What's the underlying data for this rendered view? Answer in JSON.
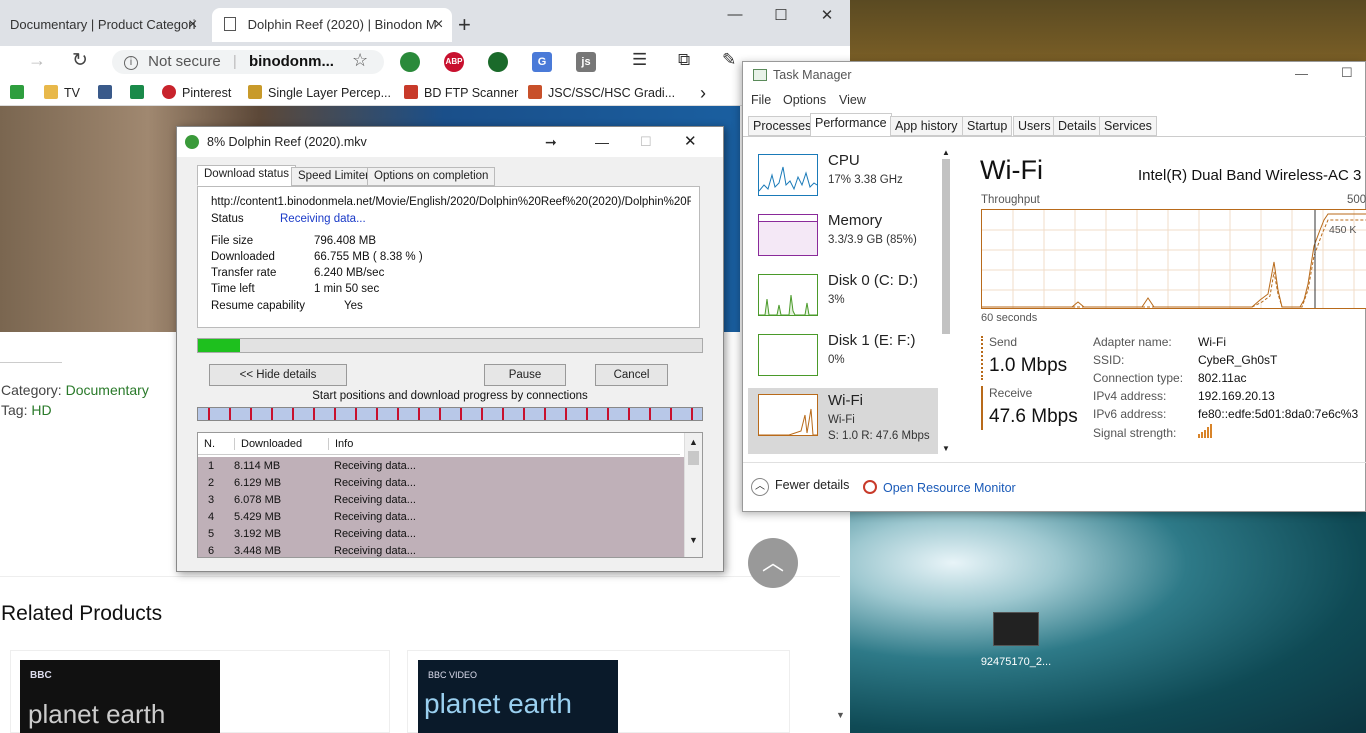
{
  "browser": {
    "tabs": [
      {
        "label": "Documentary | Product Categori",
        "close": "×"
      },
      {
        "label": "Dolphin Reef (2020) | Binodon M",
        "close": "×"
      }
    ],
    "new_tab": "+",
    "window_controls": {
      "minimize": "—",
      "maximize": "☐",
      "close": "✕"
    },
    "not_secure": "Not secure",
    "url": "binodonm...",
    "bookmarks": [
      {
        "label": "",
        "color": "#2e9e3e",
        "icon": "upwork-icon"
      },
      {
        "label": "TV",
        "color": "#e8b84a",
        "icon": "folder-icon"
      },
      {
        "label": "",
        "color": "#3a5a8a",
        "icon": "search-q-icon"
      },
      {
        "label": "",
        "color": "#1a8a4a",
        "icon": "green-plus-icon"
      },
      {
        "label": "Pinterest",
        "color": "#c8232c",
        "icon": "pinterest-icon"
      },
      {
        "label": "Single Layer Percep...",
        "color": "#c89a2a",
        "icon": "page-icon"
      },
      {
        "label": "BD FTP Scanner",
        "color": "#c83a2a",
        "icon": "ftp-icon"
      },
      {
        "label": "JSC/SSC/HSC Gradi...",
        "color": "#c8502a",
        "icon": "edu-icon"
      }
    ],
    "bookmarks_more": "›"
  },
  "page": {
    "category_label": "Category:",
    "category_value": "Documentary",
    "tag_label": "Tag:",
    "tag_value": "HD",
    "related_heading": "Related Products",
    "products": [
      {
        "badge": "BBC",
        "title": "planet earth"
      },
      {
        "badge": "BBC VIDEO",
        "title": "planet earth"
      }
    ],
    "scroll_top": "︿"
  },
  "idm": {
    "title": "8% Dolphin Reef (2020).mkv",
    "tabs": [
      "Download status",
      "Speed Limiter",
      "Options on completion"
    ],
    "url": "http://content1.binodonmela.net/Movie/English/2020/Dolphin%20Reef%20(2020)/Dolphin%20Ree",
    "status_label": "Status",
    "status_value": "Receiving data...",
    "fields": [
      {
        "label": "File size",
        "value": "796.408  MB"
      },
      {
        "label": "Downloaded",
        "value": "66.755  MB  ( 8.38 % )"
      },
      {
        "label": "Transfer rate",
        "value": "6.240  MB/sec"
      },
      {
        "label": "Time left",
        "value": "1 min 50 sec"
      },
      {
        "label": "Resume capability",
        "value": "Yes"
      }
    ],
    "progress": 0.0838,
    "hide_details": "<< Hide details",
    "pause": "Pause",
    "cancel": "Cancel",
    "connections_caption": "Start positions and download progress by connections",
    "table_headers": [
      "N.",
      "Downloaded",
      "Info"
    ],
    "rows": [
      {
        "n": "1",
        "downloaded": "8.114  MB",
        "info": "Receiving data..."
      },
      {
        "n": "2",
        "downloaded": "6.129  MB",
        "info": "Receiving data..."
      },
      {
        "n": "3",
        "downloaded": "6.078  MB",
        "info": "Receiving data..."
      },
      {
        "n": "4",
        "downloaded": "5.429  MB",
        "info": "Receiving data..."
      },
      {
        "n": "5",
        "downloaded": "3.192  MB",
        "info": "Receiving data..."
      },
      {
        "n": "6",
        "downloaded": "3.448  MB",
        "info": "Receiving data..."
      }
    ]
  },
  "taskmanager": {
    "title": "Task Manager",
    "menu": [
      "File",
      "Options",
      "View"
    ],
    "tabs": [
      "Processes",
      "Performance",
      "App history",
      "Startup",
      "Users",
      "Details",
      "Services"
    ],
    "active_tab": "Performance",
    "sidebar": [
      {
        "name": "CPU",
        "sub": "17%  3.38 GHz",
        "color": "#1a7ab8"
      },
      {
        "name": "Memory",
        "sub": "3.3/3.9 GB (85%)",
        "color": "#8a2a9a"
      },
      {
        "name": "Disk 0 (C: D:)",
        "sub": "3%",
        "color": "#4a9a2a"
      },
      {
        "name": "Disk 1 (E: F:)",
        "sub": "0%",
        "color": "#4a9a2a"
      },
      {
        "name": "Wi-Fi",
        "sub": "Wi-Fi",
        "sub2": "S: 1.0  R: 47.6 Mbps",
        "color": "#b86a1a"
      }
    ],
    "heading": "Wi-Fi",
    "adapter": "Intel(R) Dual Band Wireless-AC 3",
    "throughput_label": "Throughput",
    "scale_max": "500",
    "scale_mid": "450 K",
    "time_label": "60 seconds",
    "send_label": "Send",
    "send_value": "1.0 Mbps",
    "receive_label": "Receive",
    "receive_value": "47.6 Mbps",
    "details": [
      {
        "label": "Adapter name:",
        "value": "Wi-Fi"
      },
      {
        "label": "SSID:",
        "value": "CybeR_Gh0sT"
      },
      {
        "label": "Connection type:",
        "value": "802.11ac"
      },
      {
        "label": "IPv4 address:",
        "value": "192.169.20.13"
      },
      {
        "label": "IPv6 address:",
        "value": "fe80::edfe:5d01:8da0:7e6c%3"
      },
      {
        "label": "Signal strength:",
        "value": ""
      }
    ],
    "fewer_details": "Fewer details",
    "open_resource_monitor": "Open Resource Monitor"
  },
  "desktop": {
    "icon_label": "92475170_2..."
  }
}
